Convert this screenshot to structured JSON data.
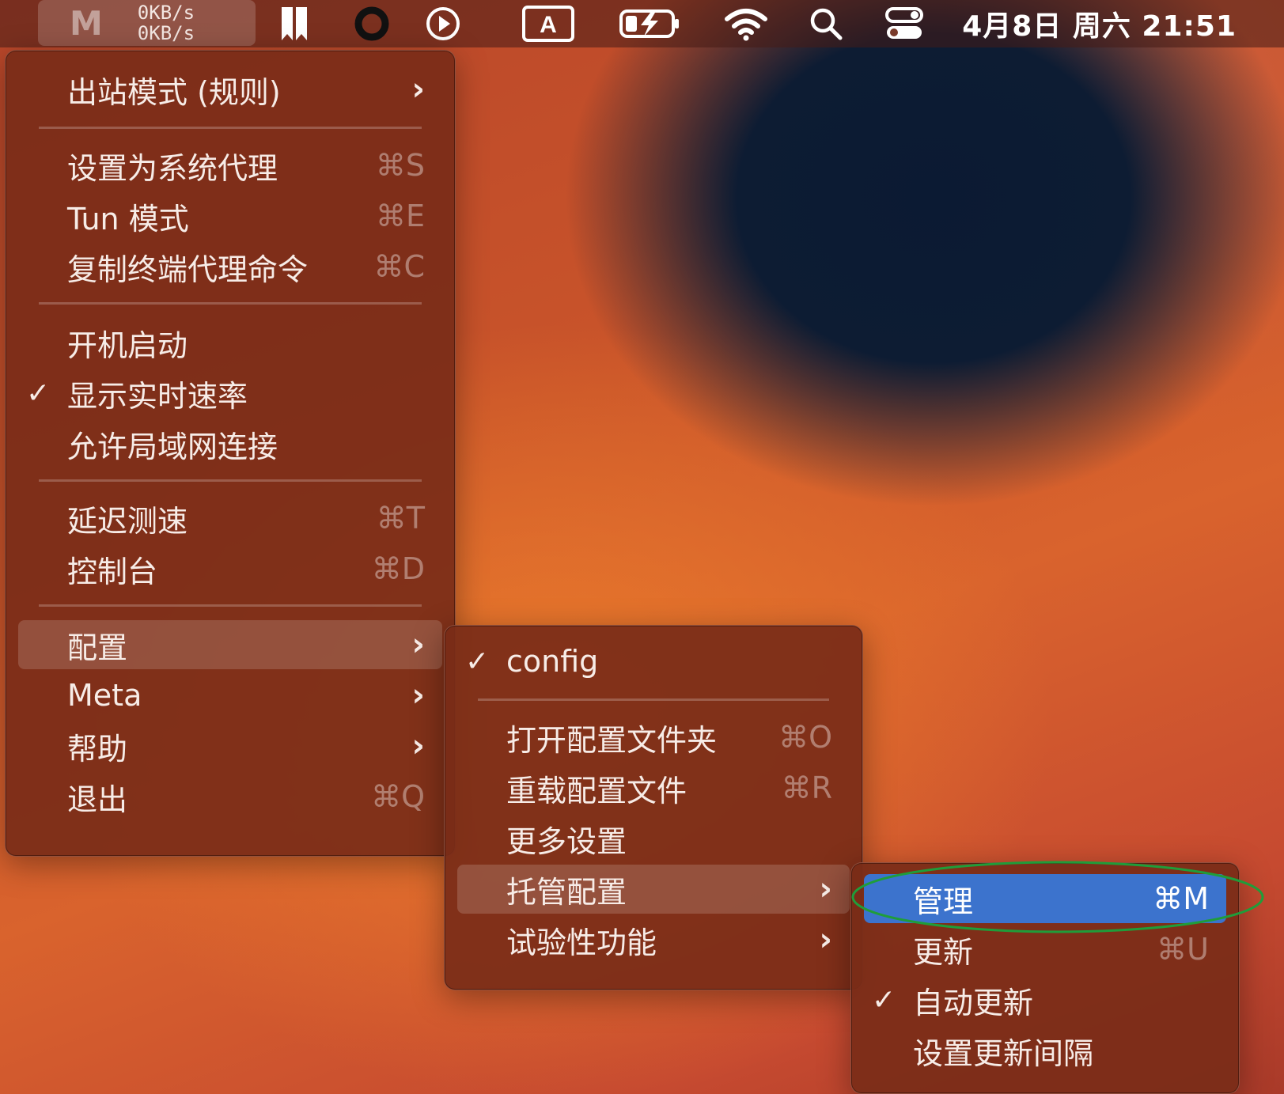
{
  "menubar": {
    "app_logo": "M",
    "speed_up": "0KB/s",
    "speed_down": "0KB/s",
    "clock": "4月8日 周六  21:51",
    "icons": [
      "bookmark-icon",
      "circle-ring-icon",
      "play-icon",
      "input-source-icon",
      "battery-charging-icon",
      "wifi-icon",
      "search-icon",
      "control-center-icon"
    ],
    "input_source_letter": "A"
  },
  "main_menu": {
    "items": [
      {
        "label": "出站模式 (规则)",
        "submenu": true
      },
      {
        "label": "设置为系统代理",
        "shortcut": "⌘S"
      },
      {
        "label": "Tun 模式",
        "shortcut": "⌘E"
      },
      {
        "label": "复制终端代理命令",
        "shortcut": "⌘C"
      },
      {
        "label": "开机启动"
      },
      {
        "label": "显示实时速率",
        "checked": true
      },
      {
        "label": "允许局域网连接"
      },
      {
        "label": "延迟测速",
        "shortcut": "⌘T"
      },
      {
        "label": "控制台",
        "shortcut": "⌘D"
      },
      {
        "label": "配置",
        "submenu": true,
        "highlighted": true
      },
      {
        "label": "Meta",
        "submenu": true
      },
      {
        "label": "帮助",
        "submenu": true
      },
      {
        "label": "退出",
        "shortcut": "⌘Q"
      }
    ],
    "check_mark": "✓",
    "arrow": "›"
  },
  "config_menu": {
    "items": [
      {
        "label": "config",
        "checked": true
      },
      {
        "label": "打开配置文件夹",
        "shortcut": "⌘O"
      },
      {
        "label": "重载配置文件",
        "shortcut": "⌘R"
      },
      {
        "label": "更多设置"
      },
      {
        "label": "托管配置",
        "submenu": true,
        "highlighted": true
      },
      {
        "label": "试验性功能",
        "submenu": true
      }
    ]
  },
  "hosted_menu": {
    "items": [
      {
        "label": "管理",
        "shortcut": "⌘M",
        "selected": true
      },
      {
        "label": "更新",
        "shortcut": "⌘U"
      },
      {
        "label": "自动更新",
        "checked": true
      },
      {
        "label": "设置更新间隔"
      }
    ]
  },
  "colors": {
    "selection_blue": "#3c73cd",
    "annotation_green": "#1f9d3a",
    "menu_background": "#7a2c18"
  }
}
